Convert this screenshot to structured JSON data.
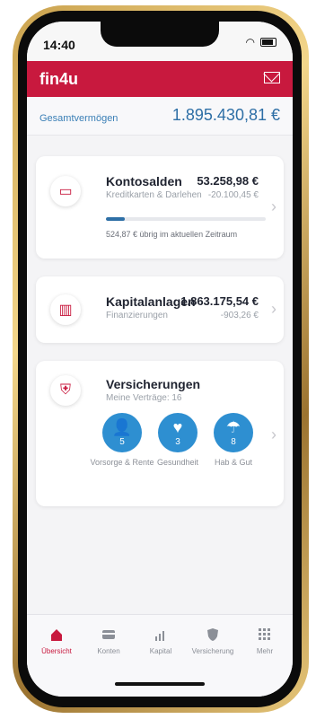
{
  "status": {
    "time": "14:40"
  },
  "brand": {
    "name": "fin4u"
  },
  "networth": {
    "label": "Gesamtvermögen",
    "value": "1.895.430,81 €"
  },
  "cards": {
    "konten": {
      "title": "Kontosalden",
      "subtitle": "Kreditkarten & Darlehen",
      "amount": "53.258,98 €",
      "sub_amount": "-20.100,45 €",
      "progress": 0.12,
      "remaining_text": "524,87 € übrig im aktuellen Zeitraum"
    },
    "kapital": {
      "title": "Kapitalanlagen",
      "subtitle": "Finanzierungen",
      "amount": "1.863.175,54 €",
      "sub_amount": "-903,26 €"
    },
    "versicherung": {
      "title": "Versicherungen",
      "subtitle": "Meine Verträge: 16",
      "bubbles": [
        {
          "label": "Vorsorge & Rente",
          "count": "5",
          "icon": "person-icon"
        },
        {
          "label": "Gesundheit",
          "count": "3",
          "icon": "heart-icon"
        },
        {
          "label": "Hab & Gut",
          "count": "8",
          "icon": "umbrella-icon"
        }
      ]
    }
  },
  "tabs": [
    {
      "label": "Übersicht",
      "icon": "home-icon",
      "active": true
    },
    {
      "label": "Konten",
      "icon": "card-icon",
      "active": false
    },
    {
      "label": "Kapital",
      "icon": "chart-icon",
      "active": false
    },
    {
      "label": "Versicherung",
      "icon": "shield-icon",
      "active": false
    },
    {
      "label": "Mehr",
      "icon": "grid-icon",
      "active": false
    }
  ],
  "colors": {
    "brand": "#c8193e",
    "accent": "#2e6fa6",
    "bubble": "#2e8fd1"
  }
}
